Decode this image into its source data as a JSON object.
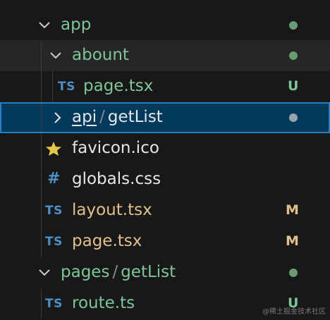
{
  "colors": {
    "background": "#181818",
    "selected_background": "#04395e",
    "selected_border": "#2a7fc4",
    "untracked_green": "#7ec699",
    "modified_yellow": "#e2c08d",
    "ts_blue": "#4d8fc7",
    "dot_green": "#6a9a72",
    "dot_grey": "#9aa3ad"
  },
  "tree": {
    "app": {
      "label": "app",
      "icon": "chevron-down-icon"
    },
    "abount": {
      "label": "abount",
      "icon": "chevron-down-icon"
    },
    "abount_page": {
      "icon_text": "TS",
      "label": "page.tsx",
      "badge": "U"
    },
    "api_getlist": {
      "seg1": "api",
      "sep": "/",
      "seg2": "getList",
      "icon": "chevron-right-icon"
    },
    "favicon": {
      "label": "favicon.ico",
      "icon": "star-icon"
    },
    "globals": {
      "icon_text": "#",
      "label": "globals.css"
    },
    "layout": {
      "icon_text": "TS",
      "label": "layout.tsx",
      "badge": "M"
    },
    "app_page": {
      "icon_text": "TS",
      "label": "page.tsx",
      "badge": "M"
    },
    "pages_getlist": {
      "seg1": "pages",
      "sep": "/",
      "seg2": "getList",
      "icon": "chevron-down-icon"
    },
    "route": {
      "icon_text": "TS",
      "label": "route.ts",
      "badge": "U"
    }
  },
  "watermark": "@稀土掘金技术社区"
}
